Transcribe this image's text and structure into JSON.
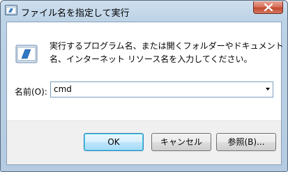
{
  "window": {
    "title": "ファイル名を指定して実行"
  },
  "description": {
    "line1": "実行するプログラム名、または開くフォルダーやドキュメント",
    "line2": "名、インターネット リソース名を入力してください。"
  },
  "name_field": {
    "label": "名前(O):",
    "value": "cmd"
  },
  "buttons": {
    "ok": "OK",
    "cancel": "キャンセル",
    "browse": "参照(B)..."
  },
  "icons": {
    "title": "run-app-icon",
    "main": "run-dialog-icon",
    "close": "close-icon",
    "dropdown": "chevron-down-icon"
  },
  "colors": {
    "title_bar": "#bcd2e6",
    "close_button": "#c24a30",
    "default_button_border": "#3c7fb1",
    "footer": "#f0f0f0"
  }
}
